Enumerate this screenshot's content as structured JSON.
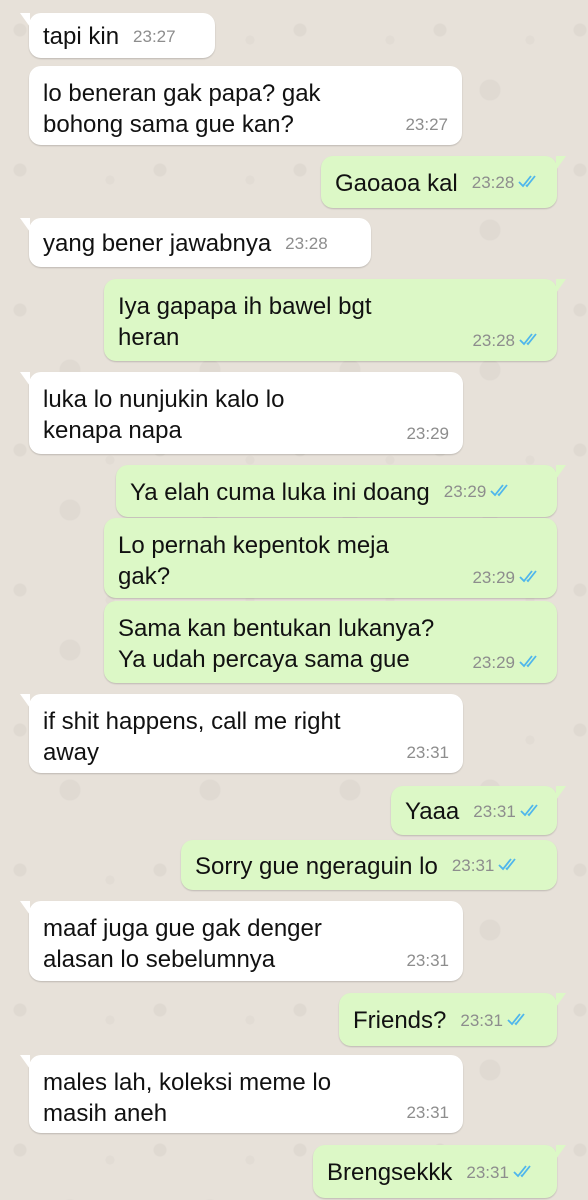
{
  "colors": {
    "incoming_bubble": "#ffffff",
    "outgoing_bubble": "#dcf8c6",
    "read_ticks": "#4fb6ec",
    "background": "#e7e1d9",
    "timestamp": "#8d8d8d"
  },
  "messages": [
    {
      "dir": "in",
      "text": "tapi kin",
      "time": "23:27",
      "tail": true
    },
    {
      "dir": "in",
      "text": "lo beneran gak papa? gak\nbohong sama gue kan?",
      "time": "23:27",
      "tail": false
    },
    {
      "dir": "out",
      "text": "Gaoaoa kal",
      "time": "23:28",
      "tail": true,
      "status": "read-double-check-icon"
    },
    {
      "dir": "in",
      "text": "yang bener jawabnya",
      "time": "23:28",
      "tail": true
    },
    {
      "dir": "out",
      "text": "Iya gapapa ih bawel bgt\nheran",
      "time": "23:28",
      "tail": true,
      "status": "read-double-check-icon"
    },
    {
      "dir": "in",
      "text": "luka lo nunjukin kalo lo\nkenapa napa",
      "time": "23:29",
      "tail": true
    },
    {
      "dir": "out",
      "text": "Ya elah cuma luka ini doang",
      "time": "23:29",
      "tail": true,
      "status": "read-double-check-icon"
    },
    {
      "dir": "out",
      "text": "Lo pernah kepentok meja\ngak?",
      "time": "23:29",
      "tail": false,
      "status": "read-double-check-icon"
    },
    {
      "dir": "out",
      "text": "Sama kan bentukan lukanya?\nYa udah percaya sama gue",
      "time": "23:29",
      "tail": false,
      "status": "read-double-check-icon"
    },
    {
      "dir": "in",
      "text": "if shit happens, call me right\naway",
      "time": "23:31",
      "tail": true
    },
    {
      "dir": "out",
      "text": "Yaaa",
      "time": "23:31",
      "tail": true,
      "status": "read-double-check-icon"
    },
    {
      "dir": "out",
      "text": "Sorry gue ngeraguin lo",
      "time": "23:31",
      "tail": false,
      "status": "read-double-check-icon"
    },
    {
      "dir": "in",
      "text": "maaf juga gue gak denger\nalasan lo sebelumnya",
      "time": "23:31",
      "tail": true
    },
    {
      "dir": "out",
      "text": "Friends?",
      "time": "23:31",
      "tail": true,
      "status": "read-double-check-icon"
    },
    {
      "dir": "in",
      "text": "males lah, koleksi meme lo\nmasih aneh",
      "time": "23:31",
      "tail": true
    },
    {
      "dir": "out",
      "text": "Brengsekkk",
      "time": "23:31",
      "tail": true,
      "status": "read-double-check-icon"
    }
  ]
}
